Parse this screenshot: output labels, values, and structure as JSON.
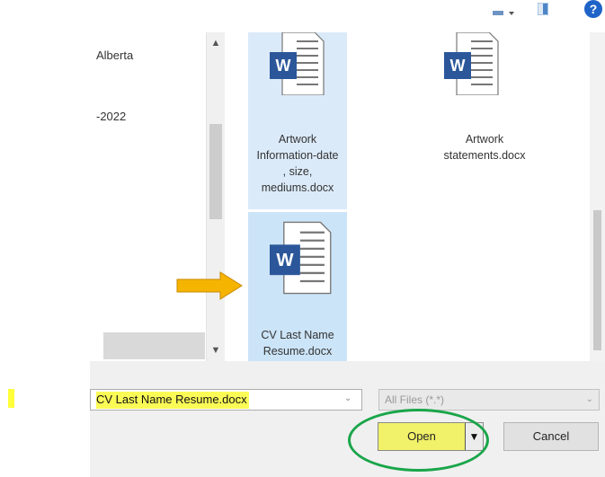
{
  "nav": {
    "items": [
      {
        "label": "Alberta"
      },
      {
        "label": "-2022"
      }
    ]
  },
  "files": [
    {
      "name_lines": [
        "Artwork",
        "Information-date",
        ", size,",
        "mediums.docx"
      ],
      "icon": "word-document-icon",
      "state": "hover"
    },
    {
      "name_lines": [
        "Artwork",
        "statements.docx"
      ],
      "icon": "word-document-icon",
      "state": "normal"
    },
    {
      "name_lines": [
        "CV Last Name",
        "Resume.docx"
      ],
      "icon": "word-document-icon",
      "state": "selected"
    }
  ],
  "footer": {
    "filename_value": "CV Last Name Resume.docx",
    "file_type_filter": "All Files (*.*)",
    "open_label": "Open",
    "open_split_glyph": "▼",
    "cancel_label": "Cancel"
  },
  "toolbar": {
    "help_glyph": "?"
  },
  "glyphs": {
    "scroll_up": "▲",
    "scroll_down": "▼",
    "dropdown": "⌄"
  },
  "annotations": {
    "arrow_color": "#f5b400",
    "ring_color": "#1aa54a",
    "highlight_color": "#fbfb57"
  }
}
